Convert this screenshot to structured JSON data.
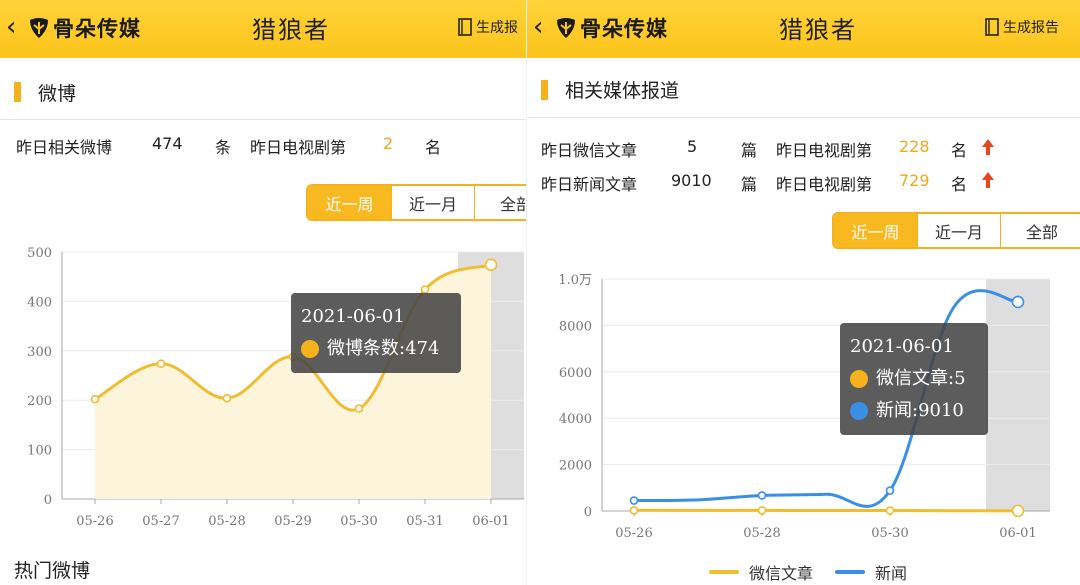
{
  "left": {
    "header": {
      "back_glyph": "‹",
      "logo_text": "骨朵传媒",
      "title": "猎狼者",
      "report_label": "生成报"
    },
    "section_title": "微博",
    "stats": {
      "weibo_label": "昨日相关微博",
      "weibo_value": "474",
      "weibo_unit": "条",
      "tv_label": "昨日电视剧第",
      "tv_rank": "2",
      "tv_unit": "名"
    },
    "range_tabs": [
      "近一周",
      "近一月",
      "全部"
    ],
    "tooltip": {
      "date": "2021-06-01",
      "label": "微博条数",
      "value": "474"
    },
    "hot_title": "热门微博"
  },
  "right": {
    "header": {
      "back_glyph": "‹",
      "logo_text": "骨朵传媒",
      "title": "猎狼者",
      "report_label": "生成报告"
    },
    "section_title": "相关媒体报道",
    "stats": {
      "wechat_label": "昨日微信文章",
      "wechat_value": "5",
      "wechat_unit": "篇",
      "wechat_tv_label": "昨日电视剧第",
      "wechat_tv_rank": "228",
      "wechat_tv_unit": "名",
      "news_label": "昨日新闻文章",
      "news_value": "9010",
      "news_unit": "篇",
      "news_tv_label": "昨日电视剧第",
      "news_tv_rank": "729",
      "news_tv_unit": "名"
    },
    "range_tabs": [
      "近一周",
      "近一月",
      "全部"
    ],
    "tooltip": {
      "date": "2021-06-01",
      "series1_label": "微信文章",
      "series1_value": "5",
      "series2_label": "新闻",
      "series2_value": "9010"
    },
    "legend": [
      "微信文章",
      "新闻"
    ]
  },
  "colors": {
    "accent": "#f6b21c",
    "yellow_series": "#f0bd30",
    "blue_series": "#3a8ee6",
    "rank_gold": "#f0a81c",
    "arrow_red": "#e8451e"
  },
  "icons": {
    "back": "chevron-left-icon",
    "logo": "leaf-logo-icon",
    "report": "document-icon",
    "rank_up": "arrow-up-icon"
  },
  "chart_data": [
    {
      "type": "area",
      "categories": [
        "05-26",
        "05-27",
        "05-28",
        "05-29",
        "05-30",
        "05-31",
        "06-01"
      ],
      "series": [
        {
          "name": "微博条数",
          "values": [
            202,
            274,
            204,
            288,
            183,
            424,
            474
          ]
        }
      ],
      "ylim": [
        0,
        500
      ],
      "yticks": [
        "0",
        "100",
        "200",
        "300",
        "400",
        "500"
      ],
      "highlight_category": "06-01",
      "grid": true
    },
    {
      "type": "line",
      "categories": [
        "05-26",
        "05-27",
        "05-28",
        "05-29",
        "05-30",
        "05-31",
        "06-01"
      ],
      "xtick_labels": [
        "05-26",
        "05-28",
        "05-30",
        "06-01"
      ],
      "series": [
        {
          "name": "微信文章",
          "values": [
            30,
            25,
            25,
            20,
            20,
            10,
            5
          ]
        },
        {
          "name": "新闻",
          "values": [
            450,
            480,
            670,
            720,
            880,
            8800,
            9010
          ]
        }
      ],
      "ylim": [
        0,
        10000
      ],
      "yticks": [
        "0",
        "2000",
        "4000",
        "6000",
        "8000",
        "1.0万"
      ],
      "highlight_category": "06-01",
      "legend_position": "bottom",
      "grid": true
    }
  ]
}
